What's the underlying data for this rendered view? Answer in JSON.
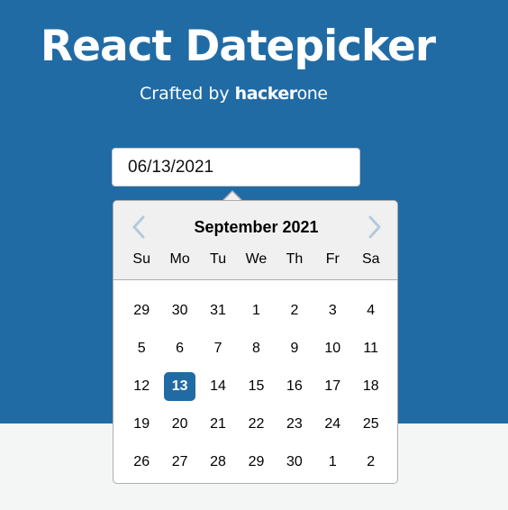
{
  "header": {
    "title": "React Datepicker",
    "subtitle_prefix": "Crafted by ",
    "brand_bold": "hacker",
    "brand_light": "one"
  },
  "input": {
    "value": "06/13/2021"
  },
  "calendar": {
    "month_label": "September 2021",
    "prev_icon": "chevron-left-icon",
    "next_icon": "chevron-right-icon",
    "weekdays": [
      "Su",
      "Mo",
      "Tu",
      "We",
      "Th",
      "Fr",
      "Sa"
    ],
    "weeks": [
      [
        "29",
        "30",
        "31",
        "1",
        "2",
        "3",
        "4"
      ],
      [
        "5",
        "6",
        "7",
        "8",
        "9",
        "10",
        "11"
      ],
      [
        "12",
        "13",
        "14",
        "15",
        "16",
        "17",
        "18"
      ],
      [
        "19",
        "20",
        "21",
        "22",
        "23",
        "24",
        "25"
      ],
      [
        "26",
        "27",
        "28",
        "29",
        "30",
        "1",
        "2"
      ]
    ],
    "selected_day": "13"
  },
  "colors": {
    "brand_blue": "#216ba5",
    "header_gray": "#f0f0f0",
    "page_bg": "#f4f5f5",
    "nav_arrow": "#b3c9dd"
  }
}
